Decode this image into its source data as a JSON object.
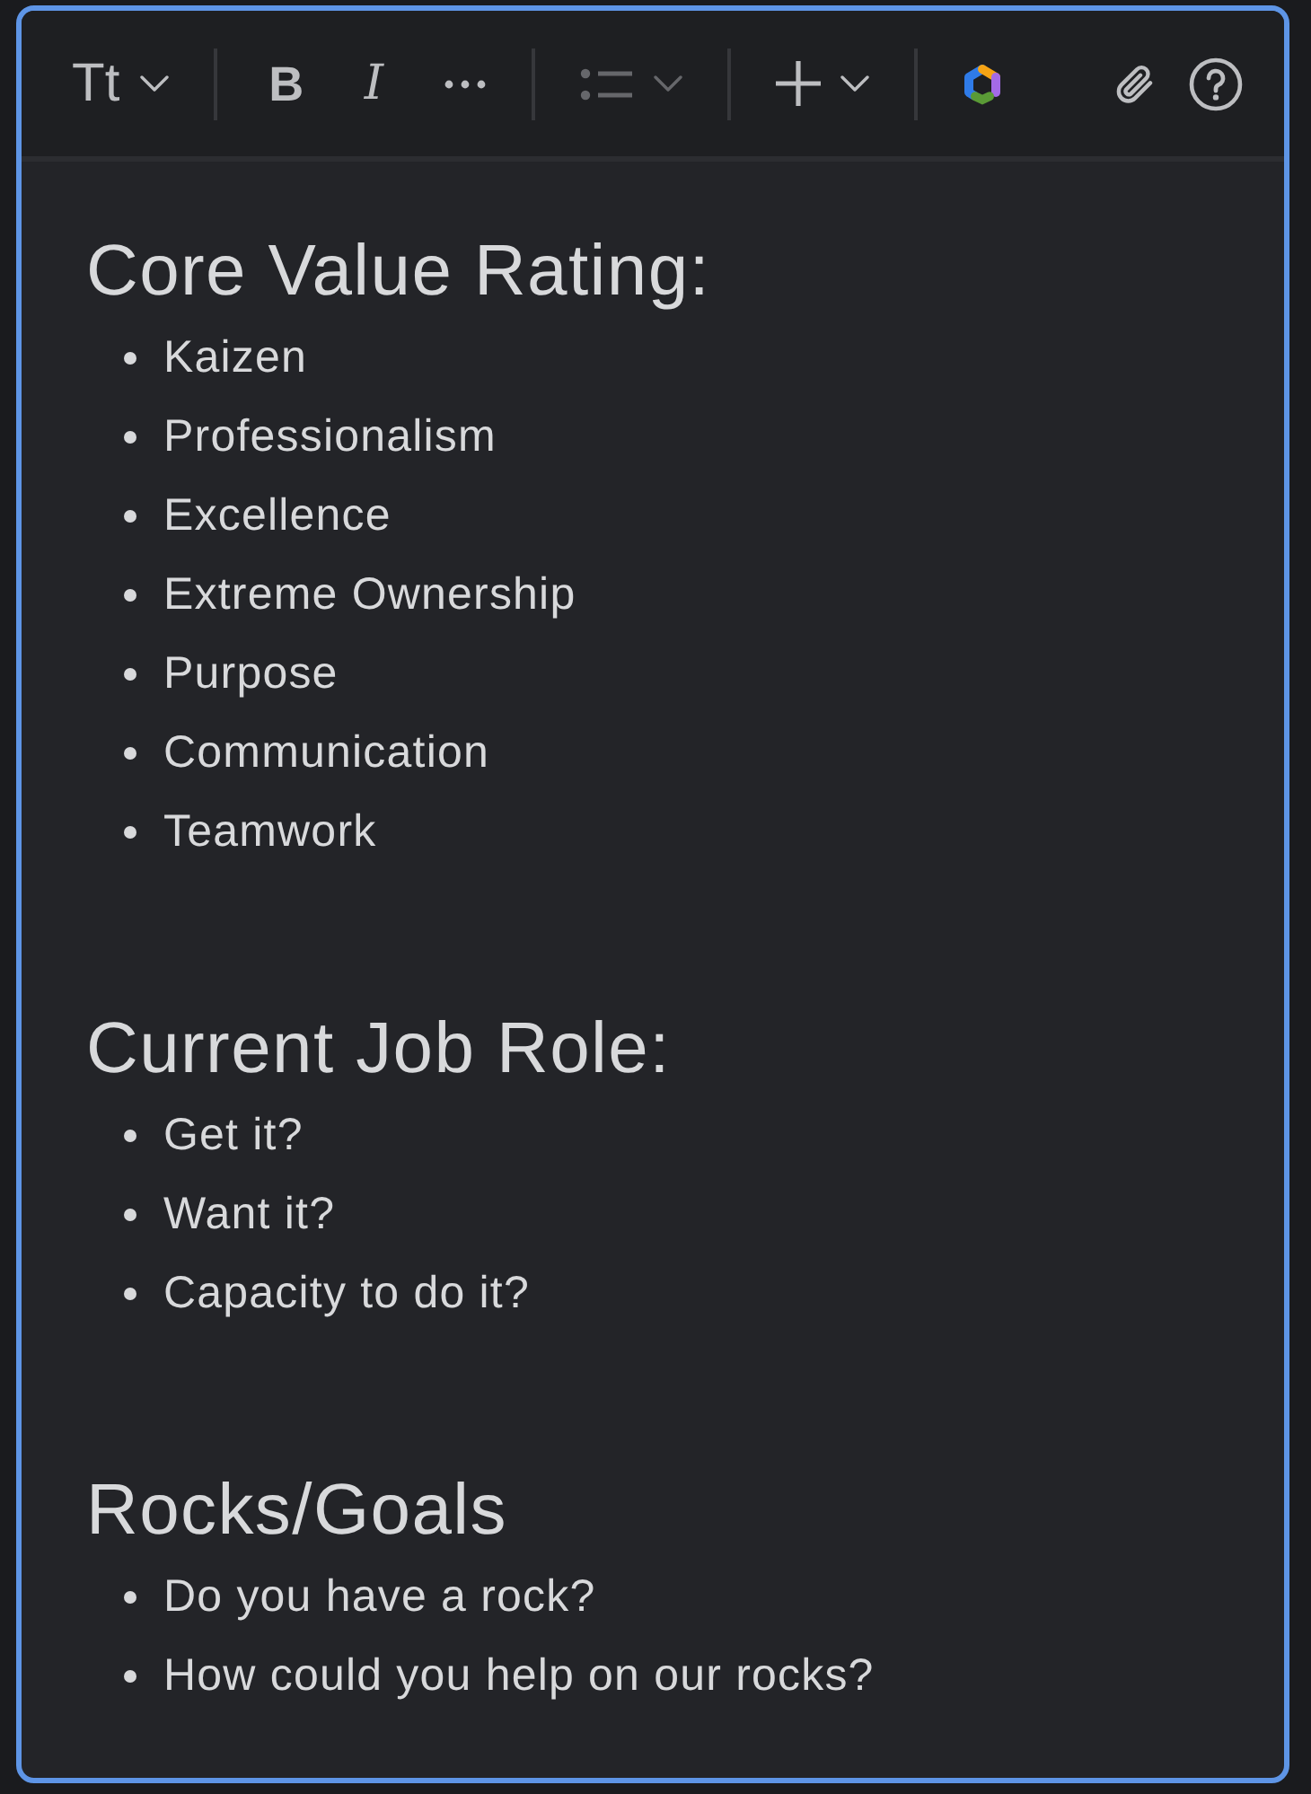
{
  "toolbar": {
    "groups": [
      [
        {
          "kind": "text-style",
          "label": "Tt",
          "dropdown": true,
          "disabled": false
        }
      ],
      [
        {
          "kind": "bold",
          "label": "B",
          "dropdown": false,
          "disabled": false
        },
        {
          "kind": "italic",
          "label": "I",
          "dropdown": false,
          "disabled": false
        },
        {
          "kind": "more",
          "dropdown": false,
          "disabled": false
        }
      ],
      [
        {
          "kind": "list",
          "dropdown": true,
          "disabled": true
        }
      ],
      [
        {
          "kind": "insert",
          "dropdown": true,
          "disabled": false
        }
      ],
      [
        {
          "kind": "ai",
          "dropdown": false,
          "disabled": false
        }
      ]
    ],
    "end": [
      {
        "kind": "attach",
        "dropdown": false,
        "disabled": false
      },
      {
        "kind": "help",
        "dropdown": false,
        "disabled": false
      }
    ]
  },
  "sections": [
    {
      "heading": "Core Value Rating:",
      "items": [
        "Kaizen",
        "Professionalism",
        "Excellence",
        "Extreme Ownership",
        "Purpose",
        "Communication",
        "Teamwork"
      ]
    },
    {
      "heading": "Current Job Role:",
      "items": [
        "Get it?",
        "Want it?",
        "Capacity to do it?"
      ]
    },
    {
      "heading": "Rocks/Goals",
      "items": [
        "Do you have a rock?",
        "How could you help on our rocks?"
      ]
    }
  ]
}
